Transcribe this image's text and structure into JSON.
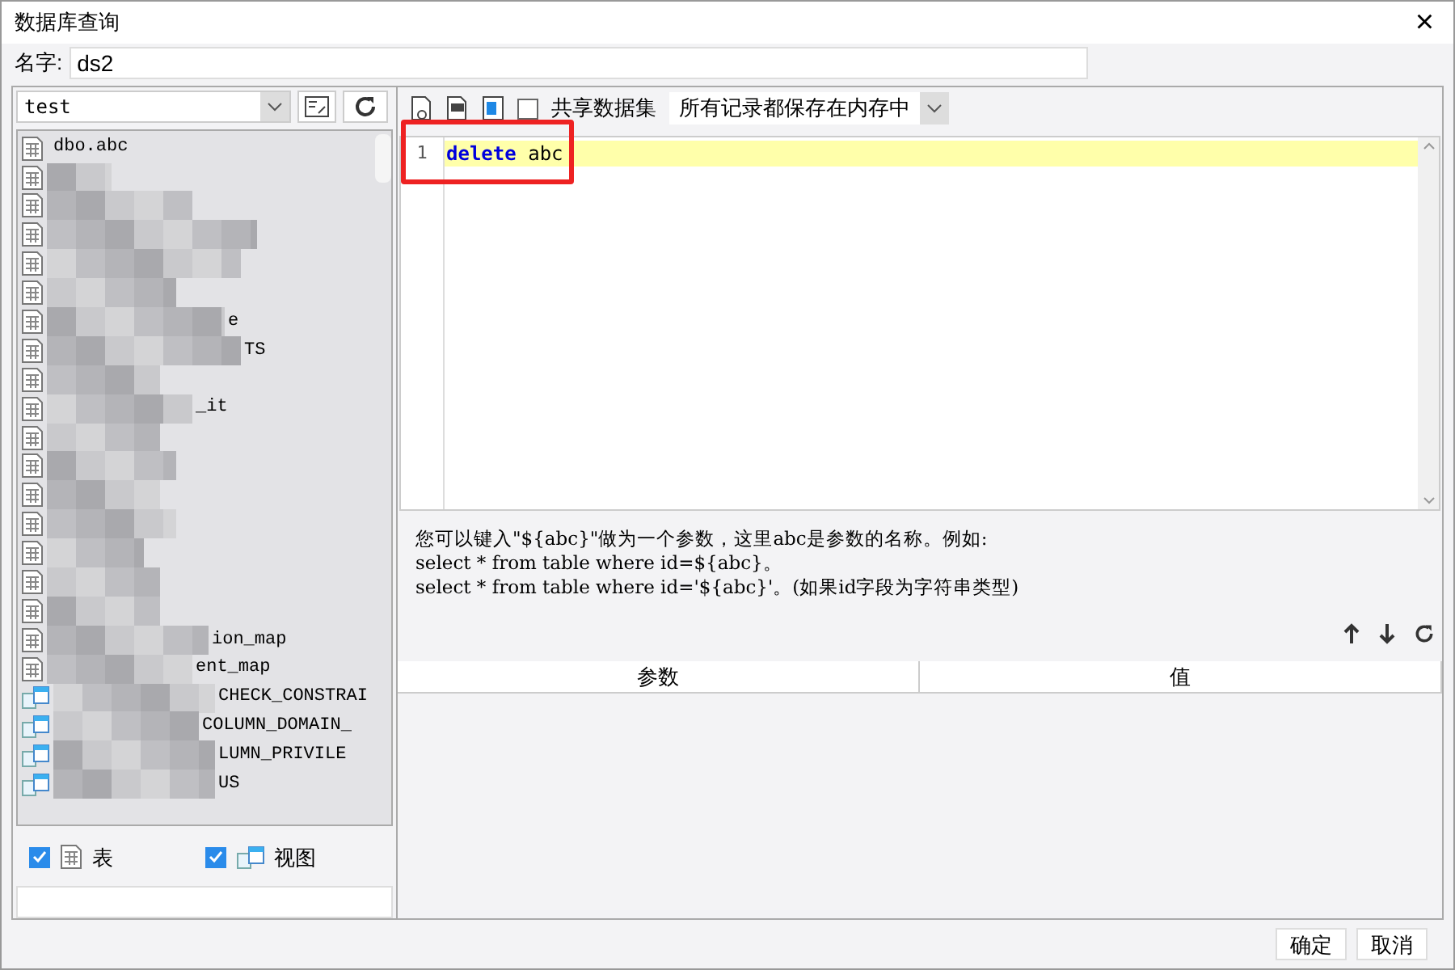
{
  "window": {
    "title": "数据库查询",
    "close": "×"
  },
  "name_field": {
    "label": "名字:",
    "value": "ds2"
  },
  "connection": {
    "value": "test"
  },
  "tree": {
    "items": [
      {
        "kind": "table",
        "label": "dbo.abc"
      },
      {
        "kind": "table"
      },
      {
        "kind": "table"
      },
      {
        "kind": "table"
      },
      {
        "kind": "table"
      },
      {
        "kind": "table"
      },
      {
        "kind": "table",
        "label": "e"
      },
      {
        "kind": "table",
        "label": "TS"
      },
      {
        "kind": "table"
      },
      {
        "kind": "table",
        "label": "_it"
      },
      {
        "kind": "table"
      },
      {
        "kind": "table"
      },
      {
        "kind": "table"
      },
      {
        "kind": "table"
      },
      {
        "kind": "table"
      },
      {
        "kind": "table"
      },
      {
        "kind": "table"
      },
      {
        "kind": "table",
        "label": "ion_map"
      },
      {
        "kind": "table",
        "label": "ent_map"
      },
      {
        "kind": "view",
        "label": "CHECK_CONSTRAI"
      },
      {
        "kind": "view",
        "label": "COLUMN_DOMAIN_"
      },
      {
        "kind": "view",
        "label": "LUMN_PRIVILE"
      },
      {
        "kind": "view",
        "label": "US"
      }
    ]
  },
  "filters": [
    {
      "label": "表",
      "kind": "table",
      "checked": true
    },
    {
      "label": "视图",
      "kind": "view",
      "checked": true
    }
  ],
  "toolbar": {
    "share": {
      "label": "共享数据集",
      "checked": false
    },
    "storage": "所有记录都保存在内存中"
  },
  "editor": {
    "lines": [
      {
        "number": "1",
        "keyword": "delete",
        "rest": "abc"
      }
    ]
  },
  "hint": [
    "您可以键入\"${abc}\"做为一个参数，这里abc是参数的名称。例如:",
    "select * from table where id=${abc}。",
    "select * from table where id='${abc}'。(如果id字段为字符串类型)"
  ],
  "params": {
    "columns": [
      "参数",
      "值"
    ]
  },
  "buttons": [
    "确定",
    "取消"
  ]
}
